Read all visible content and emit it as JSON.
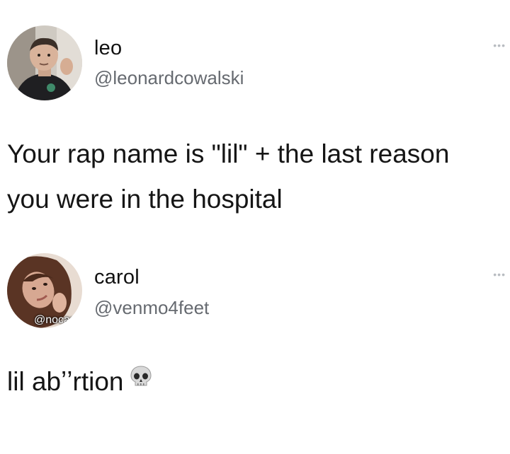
{
  "tweets": [
    {
      "name": "leo",
      "handle": "@leonardcowalski",
      "text": "Your rap name is \"lil\" + the last reason\nyou were in the hospital",
      "more_icon": "ellipsis-icon"
    },
    {
      "name": "carol",
      "handle": "@venmo4feet",
      "text": "lil abʼʼrtion",
      "emoji": "skull-emoji",
      "watermark": "@nocap",
      "more_icon": "ellipsis-icon"
    }
  ],
  "colors": {
    "background": "#ffffff",
    "name": "#111111",
    "handle": "#666a70",
    "text": "#151515"
  }
}
